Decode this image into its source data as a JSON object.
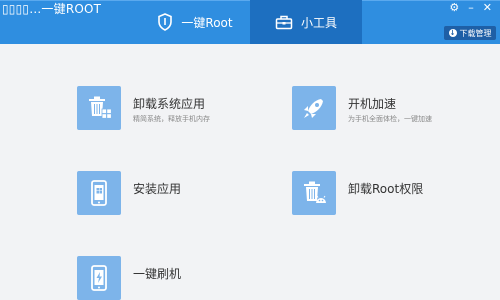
{
  "window": {
    "title": "一键ROOT",
    "icon_strip": "▯▯▯▯…",
    "controls": {
      "settings": "⚙",
      "minimize": "–",
      "close": "✕"
    }
  },
  "tabs": [
    {
      "label": "一键Root",
      "icon": "shield-icon",
      "active": false
    },
    {
      "label": "小工具",
      "icon": "toolbox-icon",
      "active": true
    }
  ],
  "download_manager": {
    "label": "下载管理"
  },
  "features": [
    {
      "title": "卸载系统应用",
      "subtitle": "精简系统，释放手机内存",
      "icon": "trash-apps-icon"
    },
    {
      "title": "开机加速",
      "subtitle": "为手机全面体检，一键加速",
      "icon": "rocket-icon"
    },
    {
      "title": "安装应用",
      "subtitle": "",
      "icon": "install-phone-icon"
    },
    {
      "title": "卸载Root权限",
      "subtitle": "",
      "icon": "trash-android-icon"
    },
    {
      "title": "一键刷机",
      "subtitle": "",
      "icon": "flash-phone-icon"
    }
  ],
  "colors": {
    "accent": "#2f8ee0",
    "active_tab": "#1d6fc0",
    "tile": "#7db4ea",
    "background": "#f2f3f5"
  }
}
